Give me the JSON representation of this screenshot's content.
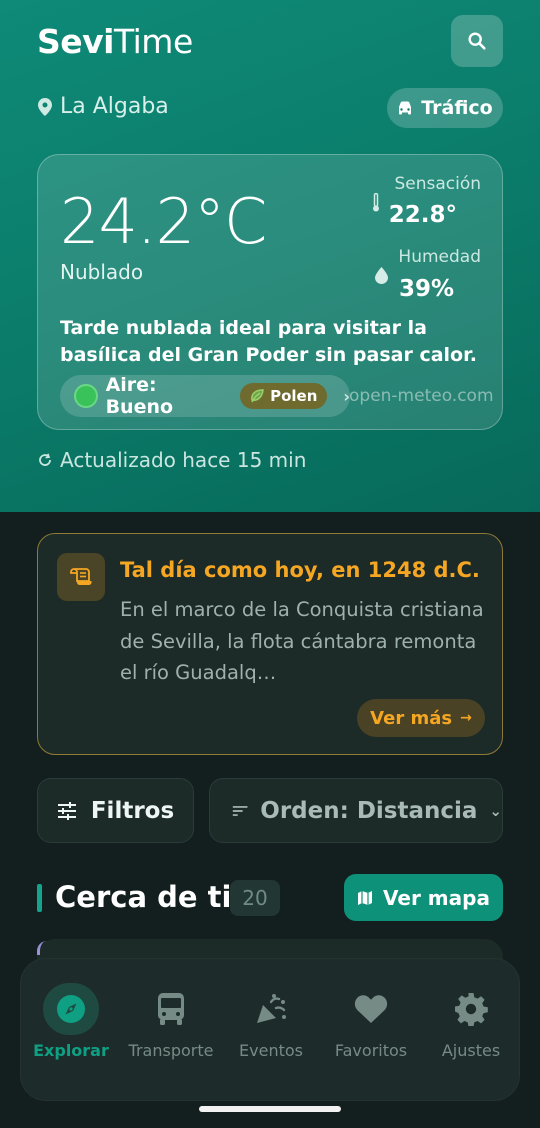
{
  "header": {
    "logo_bold": "Sevi",
    "logo_light": "Time",
    "location": "La Algaba",
    "traffic_label": "Tráfico"
  },
  "weather": {
    "temperature": "24.2°C",
    "condition": "Nublado",
    "feels_label": "Sensación",
    "feels_value": "22.8°",
    "humidity_label": "Humedad",
    "humidity_value": "39%",
    "tip": "Tarde nublada ideal para visitar la basílica del Gran Poder sin pasar calor.",
    "air_label": "Aire: Bueno",
    "pollen_label": "Polen",
    "source": "open-meteo.com",
    "updated": "Actualizado hace 15 min"
  },
  "history": {
    "title": "Tal día como hoy, en 1248 d.C.",
    "text": "En el marco de la Conquista cristiana de Sevilla, la flota cántabra remonta el río Guadalq…",
    "more_label": "Ver más"
  },
  "controls": {
    "filters_label": "Filtros",
    "order_label": "Orden: Distancia"
  },
  "nearby": {
    "title": "Cerca de ti",
    "count": "20",
    "map_label": "Ver mapa"
  },
  "nav": {
    "items": [
      {
        "label": "Explorar",
        "icon": "compass-icon"
      },
      {
        "label": "Transporte",
        "icon": "bus-icon"
      },
      {
        "label": "Eventos",
        "icon": "party-popper-icon"
      },
      {
        "label": "Favoritos",
        "icon": "heart-icon"
      },
      {
        "label": "Ajustes",
        "icon": "gear-icon"
      }
    ],
    "active_index": 0
  },
  "colors": {
    "brand": "#0e9179",
    "accent_amber": "#f5a623",
    "background": "#121f1e"
  }
}
